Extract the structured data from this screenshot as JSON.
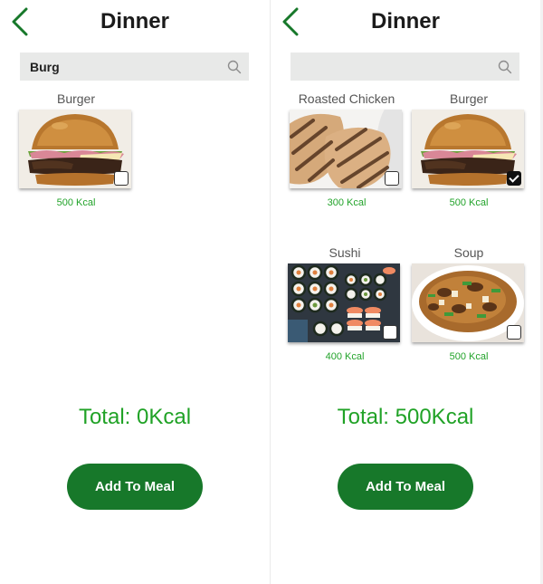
{
  "colors": {
    "accent_green": "#17782a",
    "text_green": "#22a32a",
    "search_bg": "#e8e9e8"
  },
  "screens": [
    {
      "title": "Dinner",
      "back_icon": "chevron-left-icon",
      "search": {
        "value": "Burg",
        "placeholder": ""
      },
      "items": [
        {
          "name": "Burger",
          "kcal": "500 Kcal",
          "checked": false
        }
      ],
      "total": "Total: 0Kcal",
      "button": "Add To Meal"
    },
    {
      "title": "Dinner",
      "back_icon": "chevron-left-icon",
      "search": {
        "value": "",
        "placeholder": ""
      },
      "items": [
        {
          "name": "Roasted Chicken",
          "kcal": "300 Kcal",
          "checked": false
        },
        {
          "name": "Burger",
          "kcal": "500 Kcal",
          "checked": true
        },
        {
          "name": "Sushi",
          "kcal": "400 Kcal",
          "checked": false
        },
        {
          "name": "Soup",
          "kcal": "500 Kcal",
          "checked": false
        }
      ],
      "total": "Total: 500Kcal",
      "button": "Add To Meal"
    }
  ]
}
